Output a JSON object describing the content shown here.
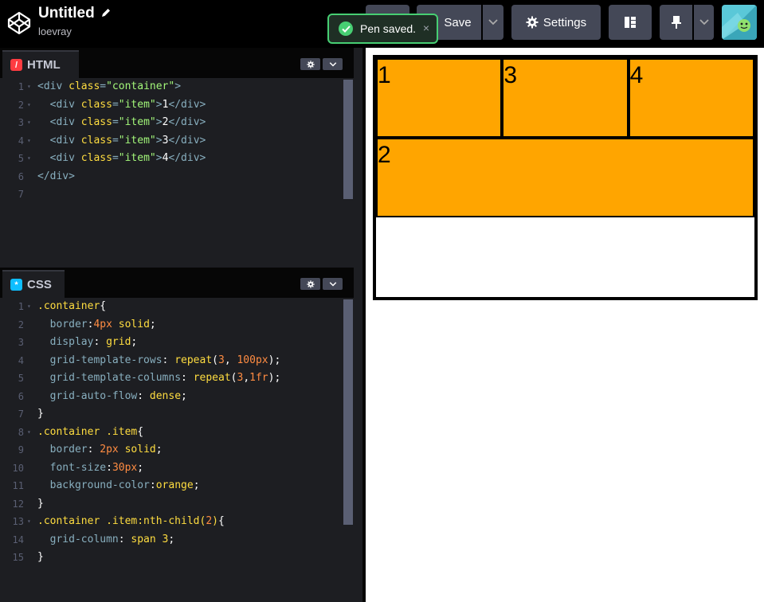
{
  "header": {
    "title": "Untitled",
    "author": "loevray",
    "buttons": {
      "save": "Save",
      "settings": "Settings"
    },
    "icons": {
      "logo": "codepen-logo-icon",
      "edit": "pencil-icon",
      "save": "cloud-icon",
      "settings": "gear-icon",
      "layout": "layout-icon",
      "pin": "pin-icon",
      "dropdown": "chevron-down-icon"
    }
  },
  "toast": {
    "message": "Pen saved.",
    "close": "×"
  },
  "editors": {
    "html": {
      "label": "HTML",
      "lines": [
        {
          "num": "1",
          "fold": true,
          "tokens": [
            [
              "punc",
              "<"
            ],
            [
              "tag",
              "div"
            ],
            [
              "punc",
              " "
            ],
            [
              "attr",
              "class"
            ],
            [
              "punc",
              "="
            ],
            [
              "str",
              "\"container\""
            ],
            [
              "punc",
              ">"
            ]
          ]
        },
        {
          "num": "2",
          "fold": true,
          "tokens": [
            [
              "text",
              "  "
            ],
            [
              "punc",
              "<"
            ],
            [
              "tag",
              "div"
            ],
            [
              "punc",
              " "
            ],
            [
              "attr",
              "class"
            ],
            [
              "punc",
              "="
            ],
            [
              "str",
              "\"item\""
            ],
            [
              "punc",
              ">"
            ],
            [
              "text",
              "1"
            ],
            [
              "punc",
              "</"
            ],
            [
              "tag",
              "div"
            ],
            [
              "punc",
              ">"
            ]
          ]
        },
        {
          "num": "3",
          "fold": true,
          "tokens": [
            [
              "text",
              "  "
            ],
            [
              "punc",
              "<"
            ],
            [
              "tag",
              "div"
            ],
            [
              "punc",
              " "
            ],
            [
              "attr",
              "class"
            ],
            [
              "punc",
              "="
            ],
            [
              "str",
              "\"item\""
            ],
            [
              "punc",
              ">"
            ],
            [
              "text",
              "2"
            ],
            [
              "punc",
              "</"
            ],
            [
              "tag",
              "div"
            ],
            [
              "punc",
              ">"
            ]
          ]
        },
        {
          "num": "4",
          "fold": true,
          "tokens": [
            [
              "text",
              "  "
            ],
            [
              "punc",
              "<"
            ],
            [
              "tag",
              "div"
            ],
            [
              "punc",
              " "
            ],
            [
              "attr",
              "class"
            ],
            [
              "punc",
              "="
            ],
            [
              "str",
              "\"item\""
            ],
            [
              "punc",
              ">"
            ],
            [
              "text",
              "3"
            ],
            [
              "punc",
              "</"
            ],
            [
              "tag",
              "div"
            ],
            [
              "punc",
              ">"
            ]
          ]
        },
        {
          "num": "5",
          "fold": true,
          "tokens": [
            [
              "text",
              "  "
            ],
            [
              "punc",
              "<"
            ],
            [
              "tag",
              "div"
            ],
            [
              "punc",
              " "
            ],
            [
              "attr",
              "class"
            ],
            [
              "punc",
              "="
            ],
            [
              "str",
              "\"item\""
            ],
            [
              "punc",
              ">"
            ],
            [
              "text",
              "4"
            ],
            [
              "punc",
              "</"
            ],
            [
              "tag",
              "div"
            ],
            [
              "punc",
              ">"
            ]
          ]
        },
        {
          "num": "6",
          "fold": false,
          "tokens": [
            [
              "punc",
              "</"
            ],
            [
              "tag",
              "div"
            ],
            [
              "punc",
              ">"
            ]
          ]
        },
        {
          "num": "7",
          "fold": false,
          "tokens": []
        }
      ]
    },
    "css": {
      "label": "CSS",
      "lines": [
        {
          "num": "1",
          "fold": true,
          "tokens": [
            [
              "sel",
              ".container"
            ],
            [
              "text",
              "{"
            ]
          ]
        },
        {
          "num": "2",
          "fold": false,
          "tokens": [
            [
              "text",
              "  "
            ],
            [
              "prop",
              "border"
            ],
            [
              "text",
              ":"
            ],
            [
              "num",
              "4px"
            ],
            [
              "text",
              " "
            ],
            [
              "kw",
              "solid"
            ],
            [
              "text",
              ";"
            ]
          ]
        },
        {
          "num": "3",
          "fold": false,
          "tokens": [
            [
              "text",
              "  "
            ],
            [
              "prop",
              "display"
            ],
            [
              "text",
              ": "
            ],
            [
              "kw",
              "grid"
            ],
            [
              "text",
              ";"
            ]
          ]
        },
        {
          "num": "4",
          "fold": false,
          "tokens": [
            [
              "text",
              "  "
            ],
            [
              "prop",
              "grid-template-rows"
            ],
            [
              "text",
              ": "
            ],
            [
              "fn",
              "repeat"
            ],
            [
              "text",
              "("
            ],
            [
              "num",
              "3"
            ],
            [
              "text",
              ", "
            ],
            [
              "num",
              "100px"
            ],
            [
              "text",
              ");"
            ]
          ]
        },
        {
          "num": "5",
          "fold": false,
          "tokens": [
            [
              "text",
              "  "
            ],
            [
              "prop",
              "grid-template-columns"
            ],
            [
              "text",
              ": "
            ],
            [
              "fn",
              "repeat"
            ],
            [
              "text",
              "("
            ],
            [
              "num",
              "3"
            ],
            [
              "text",
              ","
            ],
            [
              "num",
              "1fr"
            ],
            [
              "text",
              ");"
            ]
          ]
        },
        {
          "num": "6",
          "fold": false,
          "tokens": [
            [
              "text",
              "  "
            ],
            [
              "prop",
              "grid-auto-flow"
            ],
            [
              "text",
              ": "
            ],
            [
              "kw",
              "dense"
            ],
            [
              "text",
              ";"
            ]
          ]
        },
        {
          "num": "7",
          "fold": false,
          "tokens": [
            [
              "text",
              "}"
            ]
          ]
        },
        {
          "num": "8",
          "fold": true,
          "tokens": [
            [
              "sel",
              ".container .item"
            ],
            [
              "text",
              "{"
            ]
          ]
        },
        {
          "num": "9",
          "fold": false,
          "tokens": [
            [
              "text",
              "  "
            ],
            [
              "prop",
              "border"
            ],
            [
              "text",
              ": "
            ],
            [
              "num",
              "2px"
            ],
            [
              "text",
              " "
            ],
            [
              "kw",
              "solid"
            ],
            [
              "text",
              ";"
            ]
          ]
        },
        {
          "num": "10",
          "fold": false,
          "tokens": [
            [
              "text",
              "  "
            ],
            [
              "prop",
              "font-size"
            ],
            [
              "text",
              ":"
            ],
            [
              "num",
              "30px"
            ],
            [
              "text",
              ";"
            ]
          ]
        },
        {
          "num": "11",
          "fold": false,
          "tokens": [
            [
              "text",
              "  "
            ],
            [
              "prop",
              "background-color"
            ],
            [
              "text",
              ":"
            ],
            [
              "kw",
              "orange"
            ],
            [
              "text",
              ";"
            ]
          ]
        },
        {
          "num": "12",
          "fold": false,
          "tokens": [
            [
              "text",
              "}"
            ]
          ]
        },
        {
          "num": "13",
          "fold": true,
          "tokens": [
            [
              "sel",
              ".container .item:nth-child("
            ],
            [
              "num",
              "2"
            ],
            [
              "sel",
              ")"
            ],
            [
              "text",
              "{"
            ]
          ]
        },
        {
          "num": "14",
          "fold": false,
          "tokens": [
            [
              "text",
              "  "
            ],
            [
              "prop",
              "grid-column"
            ],
            [
              "text",
              ": "
            ],
            [
              "kw",
              "span 3"
            ],
            [
              "text",
              ";"
            ]
          ]
        },
        {
          "num": "15",
          "fold": false,
          "tokens": [
            [
              "text",
              "}"
            ]
          ]
        }
      ]
    }
  },
  "preview": {
    "items": [
      "1",
      "2",
      "3",
      "4"
    ]
  }
}
